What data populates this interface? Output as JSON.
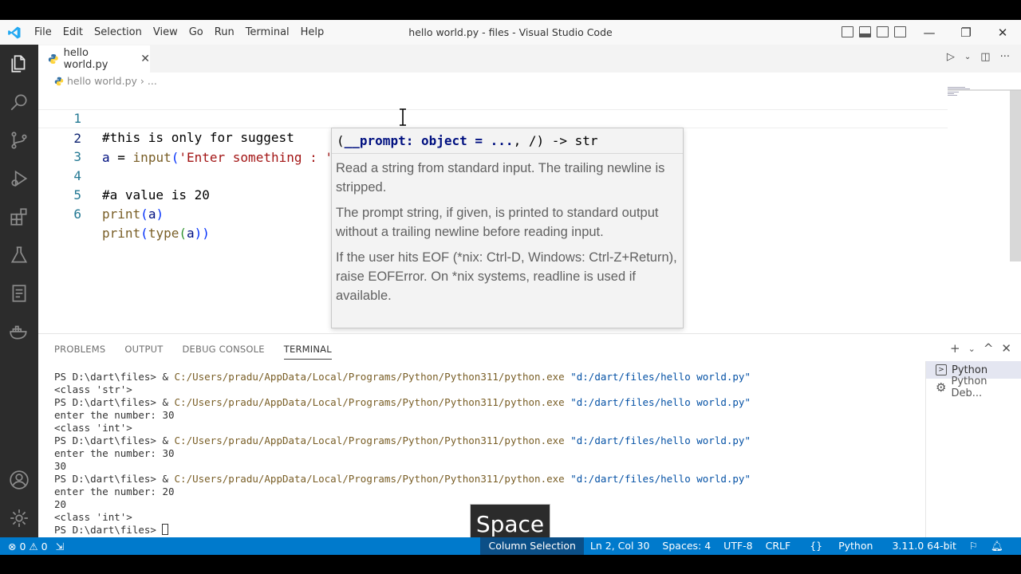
{
  "window": {
    "title": "hello world.py - files - Visual Studio Code",
    "menu": [
      "File",
      "Edit",
      "Selection",
      "View",
      "Go",
      "Run",
      "Terminal",
      "Help"
    ],
    "controls": {
      "minimize": "—",
      "restore": "❐",
      "close": "✕"
    }
  },
  "editor": {
    "tab": {
      "label": "hello world.py",
      "close": "✕"
    },
    "breadcrumb": {
      "file": "hello world.py",
      "sep": "›",
      "more": "..."
    },
    "lines": [
      {
        "num": "1",
        "text": "#this is only for suggest"
      },
      {
        "num": "2",
        "text": "a = input('Enter something : ')"
      },
      {
        "num": "3",
        "text": ""
      },
      {
        "num": "4",
        "text": "#a value is 20"
      },
      {
        "num": "5",
        "text": "print(a)"
      },
      {
        "num": "6",
        "text": "print(type(a))"
      }
    ],
    "line2_parts": {
      "var": "a",
      "eq": " = ",
      "fn": "input",
      "open": "(",
      "str": "'Enter something : '",
      "close": ")"
    },
    "line5_parts": {
      "fn": "print",
      "open": "(",
      "arg": "a",
      "close": ")"
    },
    "line6_parts": {
      "fn": "print",
      "open": "(",
      "fn2": "type",
      "open2": "(",
      "arg": "a",
      "close": "))"
    },
    "hover": {
      "sig_open": "(",
      "sig_param": "__prompt: object = ...",
      "sig_rest": ", /) -> str",
      "docs": [
        "Read a string from standard input. The trailing newline is stripped.",
        "The prompt string, if given, is printed to standard output without a trailing newline before reading input.",
        "If the user hits EOF (*nix: Ctrl-D, Windows: Ctrl-Z+Return), raise EOFError. On *nix systems, readline is used if available."
      ]
    }
  },
  "panel": {
    "tabs": [
      "PROBLEMS",
      "OUTPUT",
      "DEBUG CONSOLE",
      "TERMINAL"
    ],
    "active_tab": "TERMINAL",
    "actions": {
      "add": "+",
      "dropdown": "⌄",
      "maximize": "^",
      "close": "✕"
    },
    "terminal_prompt": "PS D:\\dart\\files> & ",
    "terminal_cmd": "C:/Users/pradu/AppData/Local/Programs/Python/Python311/python.exe",
    "terminal_arg": "\"d:/dart/files/hello world.py\"",
    "terminal_outputs": {
      "o1": "<class 'str'>",
      "o2": "enter the number: 30",
      "o3": "<class 'int'>",
      "o4": "enter the number: 30",
      "o5": "30",
      "o6": "enter the number: 20",
      "o7": "20",
      "o8": "<class 'int'>",
      "last_prompt": "PS D:\\dart\\files> "
    },
    "terminal_list": [
      "Python",
      "Python Deb..."
    ]
  },
  "overlay_key": "Space",
  "statusbar": {
    "errors": "0",
    "warnings": "0",
    "column_selection": "Column Selection",
    "position": "Ln 2, Col 30",
    "spaces": "Spaces: 4",
    "encoding": "UTF-8",
    "eol": "CRLF",
    "language": "Python",
    "interpreter": "3.11.0 64-bit"
  },
  "colors": {
    "accent": "#007acc",
    "activity_bar": "#2c2c2c",
    "line_number": "#237893"
  }
}
